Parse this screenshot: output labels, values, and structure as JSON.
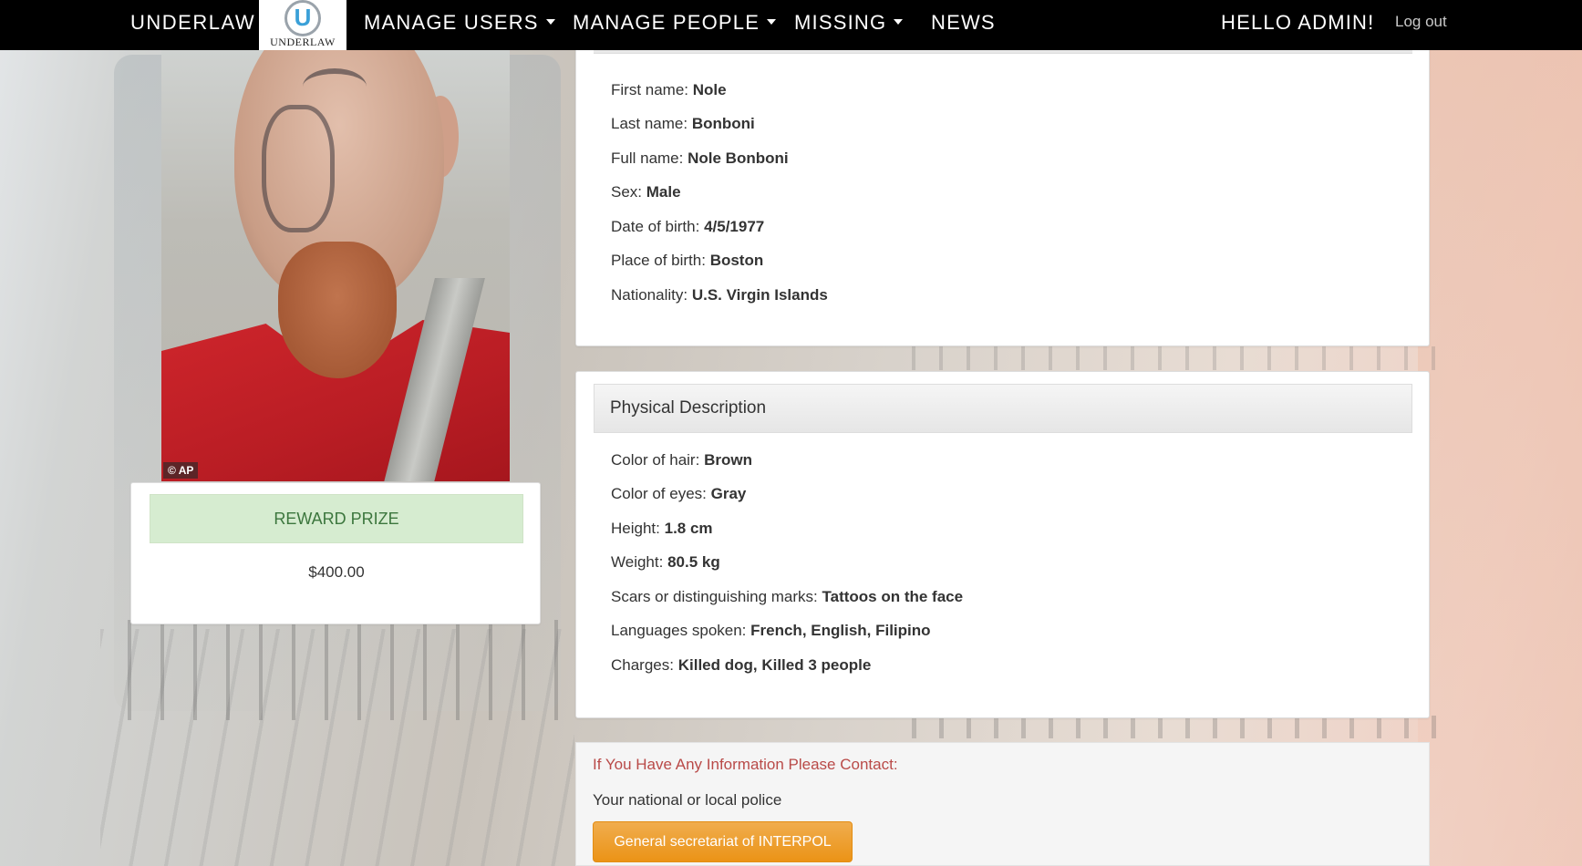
{
  "navbar": {
    "brand": "UNDERLAW",
    "logo_letter": "U",
    "logo_text": "UNDERLAW",
    "items": [
      {
        "label": "MANAGE USERS"
      },
      {
        "label": "MANAGE PEOPLE"
      },
      {
        "label": "MISSING"
      },
      {
        "label": "NEWS"
      }
    ],
    "greeting": "HELLO ADMIN!",
    "logout": "Log out"
  },
  "photo": {
    "credit": "© AP"
  },
  "reward": {
    "title": "REWARD PRIZE",
    "amount": "$400.00"
  },
  "identity": [
    {
      "label": "First name:",
      "value": "Nole"
    },
    {
      "label": "Last name:",
      "value": "Bonboni"
    },
    {
      "label": "Full name:",
      "value": "Nole Bonboni"
    },
    {
      "label": "Sex:",
      "value": "Male"
    },
    {
      "label": "Date of birth:",
      "value": "4/5/1977"
    },
    {
      "label": "Place of birth:",
      "value": "Boston"
    },
    {
      "label": "Nationality:",
      "value": "U.S. Virgin Islands"
    }
  ],
  "physical": {
    "title": "Physical Description",
    "fields": [
      {
        "label": "Color of hair:",
        "value": "Brown"
      },
      {
        "label": "Color of eyes:",
        "value": "Gray"
      },
      {
        "label": "Height:",
        "value": "1.8 cm"
      },
      {
        "label": "Weight:",
        "value": "80.5 kg"
      },
      {
        "label": "Scars or distinguishing marks:",
        "value": "Tattoos on the face"
      },
      {
        "label": "Languages spoken:",
        "value": "French, English, Filipino"
      },
      {
        "label": "Charges:",
        "value": "Killed dog, Killed 3 people"
      }
    ]
  },
  "contact": {
    "title": "If You Have Any Information Please Contact:",
    "text": "Your national or local police",
    "button": "General secretariat of INTERPOL"
  },
  "colors": {
    "navbar": "#000000",
    "reward_bg": "#d6ecd0",
    "reward_text": "#3c763d",
    "contact_title": "#b94a48",
    "button": "#f0ad4e"
  }
}
